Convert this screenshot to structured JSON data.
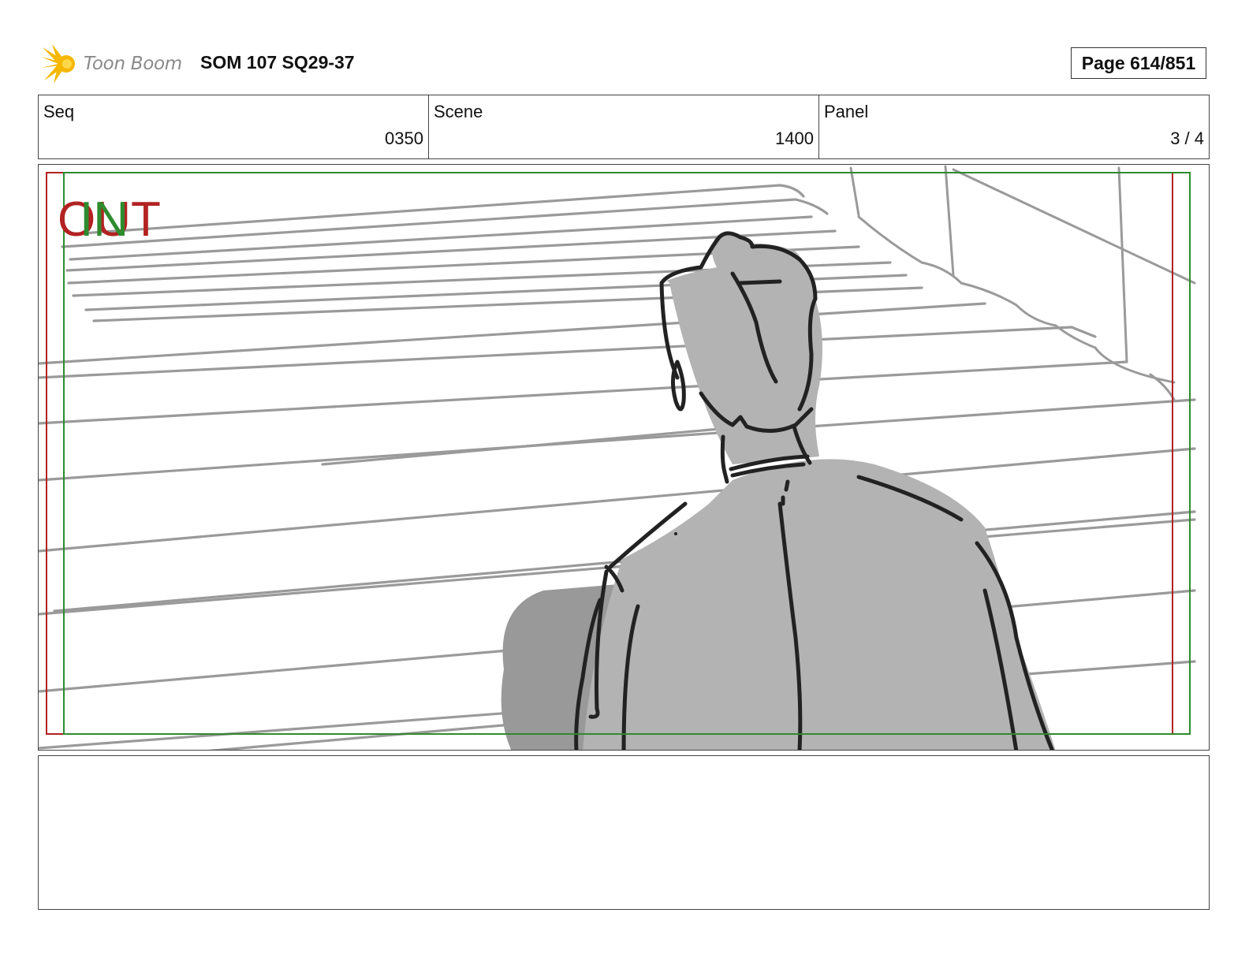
{
  "header": {
    "logo_text": "Toon Boom",
    "title": "SOM 107 SQ29-37",
    "page_label": "Page 614/851"
  },
  "info": {
    "seq_label": "Seq",
    "seq_value": "0350",
    "scene_label": "Scene",
    "scene_value": "1400",
    "panel_label": "Panel",
    "panel_value": "3 / 4"
  },
  "frame": {
    "out_marker": "OUT",
    "in_marker": "IN",
    "out_color": "#b22222",
    "in_color": "#2e8b2e"
  },
  "icons": [
    "toon-boom-logo-icon"
  ],
  "notes": {
    "text": ""
  }
}
